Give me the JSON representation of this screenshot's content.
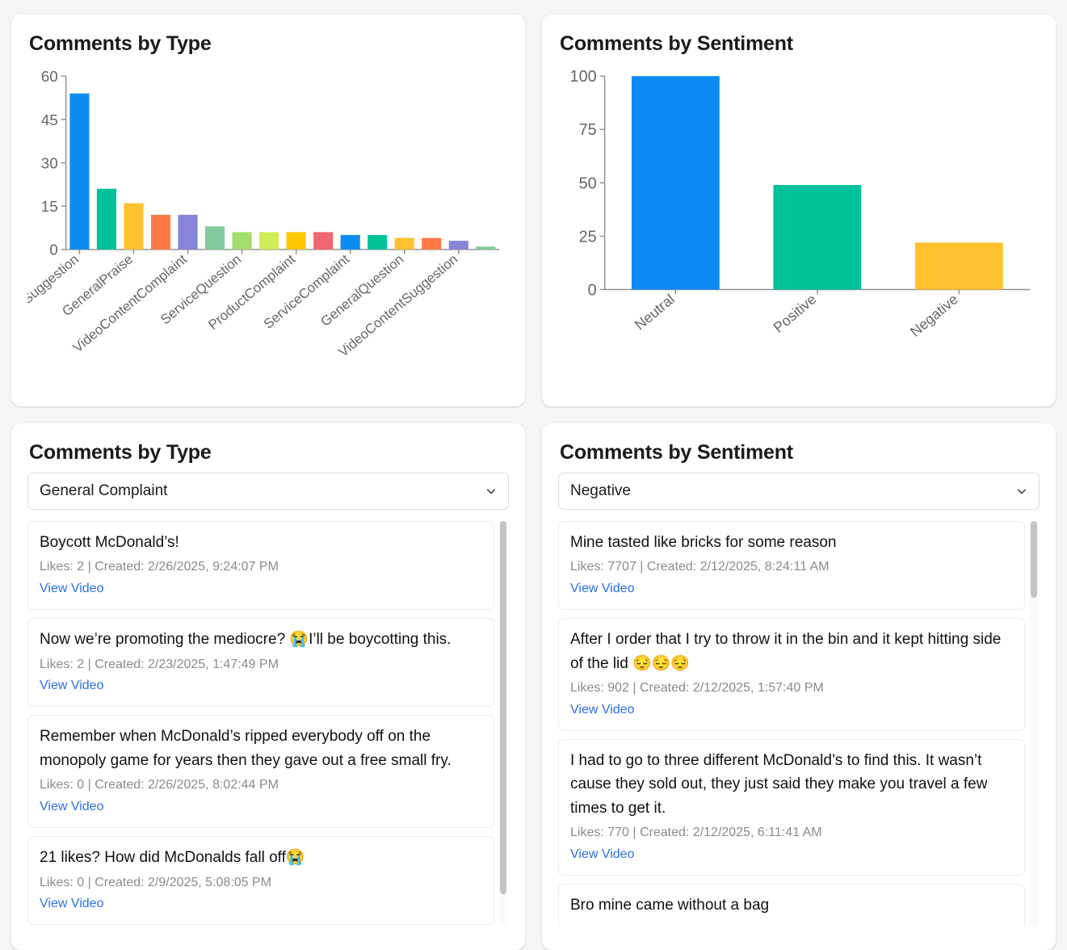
{
  "cards": {
    "type_chart_title": "Comments by Type",
    "sentiment_chart_title": "Comments by Sentiment",
    "type_list_title": "Comments by Type",
    "sentiment_list_title": "Comments by Sentiment"
  },
  "type_filter": {
    "selected": "General Complaint",
    "icon": "chevron-down-icon"
  },
  "sentiment_filter": {
    "selected": "Negative",
    "icon": "chevron-down-icon"
  },
  "type_comments": [
    {
      "text": "Boycott McDonald’s!",
      "meta": "Likes: 2 | Created: 2/26/2025, 9:24:07 PM",
      "link": "View Video"
    },
    {
      "text": "Now we’re promoting the mediocre? 😭I’ll be boycotting this.",
      "meta": "Likes: 2 | Created: 2/23/2025, 1:47:49 PM",
      "link": "View Video"
    },
    {
      "text": "Remember when McDonald’s ripped everybody off on the monopoly game for years then they gave out a free small fry.",
      "meta": "Likes: 0 | Created: 2/26/2025, 8:02:44 PM",
      "link": "View Video"
    },
    {
      "text": "21 likes? How did McDonalds fall off😭",
      "meta": "Likes: 0 | Created: 2/9/2025, 5:08:05 PM",
      "link": "View Video"
    }
  ],
  "sentiment_comments": [
    {
      "text": "Mine tasted like bricks for some reason",
      "meta": "Likes: 7707 | Created: 2/12/2025, 8:24:11 AM",
      "link": "View Video"
    },
    {
      "text": "After I order that I try to throw it in the bin and it kept hitting side of the lid 😔😔😔",
      "meta": "Likes: 902 | Created: 2/12/2025, 1:57:40 PM",
      "link": "View Video"
    },
    {
      "text": "I had to go to three different McDonald’s to find this. It wasn’t cause they sold out, they just said they make you travel a few times to get it.",
      "meta": "Likes: 770 | Created: 2/12/2025, 6:11:41 AM",
      "link": "View Video"
    },
    {
      "text": "Bro mine came without a bag",
      "meta": "",
      "link": ""
    }
  ],
  "chart_data": [
    {
      "type": "bar",
      "title": "Comments by Type",
      "xlabel": "",
      "ylabel": "",
      "ylim": [
        0,
        60
      ],
      "yticks": [
        0,
        15,
        30,
        45,
        60
      ],
      "grid": false,
      "legend": false,
      "categories": [
        "ProductSuggestion",
        "",
        "GeneralPraise",
        "",
        "VideoContentComplaint",
        "",
        "ServiceQuestion",
        "",
        "ProductComplaint",
        "",
        "ServiceComplaint",
        "",
        "GeneralQuestion",
        "",
        "VideoContentSuggestion",
        ""
      ],
      "tick_labels": [
        "ProductSuggestion",
        "GeneralPraise",
        "VideoContentComplaint",
        "ServiceQuestion",
        "ProductComplaint",
        "ServiceComplaint",
        "GeneralQuestion",
        "VideoContentSuggestion"
      ],
      "values": [
        54,
        21,
        16,
        12,
        12,
        8,
        6,
        6,
        6,
        6,
        5,
        5,
        4,
        4,
        3,
        1
      ],
      "colors": [
        "#0d8bf5",
        "#00c29a",
        "#ffc12e",
        "#ff7a45",
        "#8884d8",
        "#82ca9d",
        "#a4de6c",
        "#d0ed57",
        "#ffc800",
        "#f2666f",
        "#0d8bf5",
        "#00c29a",
        "#ffc12e",
        "#ff7a45",
        "#8884d8",
        "#82ca9d"
      ]
    },
    {
      "type": "bar",
      "title": "Comments by Sentiment",
      "xlabel": "",
      "ylabel": "",
      "ylim": [
        0,
        100
      ],
      "yticks": [
        0,
        25,
        50,
        75,
        100
      ],
      "grid": false,
      "legend": false,
      "categories": [
        "Neutral",
        "Positive",
        "Negative"
      ],
      "tick_labels": [
        "Neutral",
        "Positive",
        "Negative"
      ],
      "values": [
        100,
        49,
        22
      ],
      "colors": [
        "#0d8bf5",
        "#00c29a",
        "#ffc12e"
      ]
    }
  ],
  "scrollbars": {
    "type_list": {
      "thumb_top_pct": 0,
      "thumb_height_pct": 92
    },
    "sentiment_list": {
      "thumb_top_pct": 0,
      "thumb_height_pct": 19
    }
  }
}
